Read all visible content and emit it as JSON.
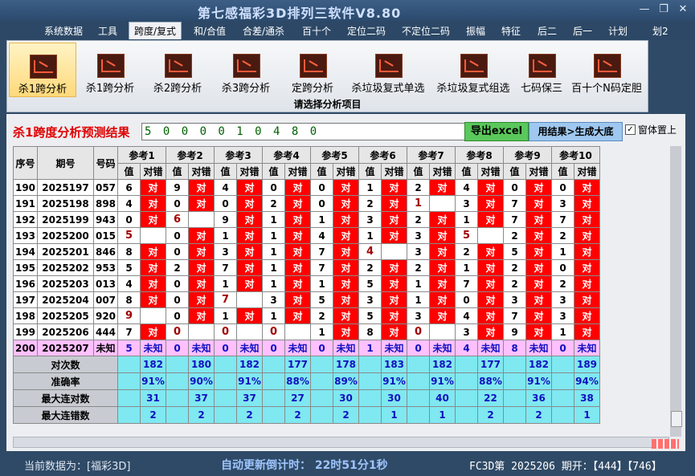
{
  "window": {
    "title": "第七感福彩3D排列三软件V8.80",
    "controls": [
      "—",
      "❐",
      "✕"
    ]
  },
  "menu": [
    "系统数据",
    "工具",
    "跨度/复式",
    "和/合值",
    "合差/通杀",
    "百十个",
    "定位二码",
    "不定位二码",
    "振幅",
    "特征",
    "后二",
    "后一",
    "计划",
    "划2"
  ],
  "ribbon": {
    "buttons": [
      "杀1跨分析",
      "杀1跨分析",
      "杀2跨分析",
      "杀3跨分析",
      "定跨分析",
      "杀垃圾复式单选",
      "杀垃圾复式组选",
      "七码保三",
      "百十个N码定胆"
    ],
    "caption": "请选择分析项目"
  },
  "result": {
    "label": "杀1跨度分析预测结果",
    "value": "5 0 0 0 0 1 0 4 8 0",
    "export_button": "导出excel",
    "generate_button": "用结果>生成大底",
    "pin_label": "窗体置上",
    "pin_checked": "✓"
  },
  "table": {
    "col_headers": [
      "序号",
      "期号",
      "号码"
    ],
    "ref_headers": [
      "参考1",
      "参考2",
      "参考3",
      "参考4",
      "参考5",
      "参考6",
      "参考7",
      "参考8",
      "参考9",
      "参考10"
    ],
    "sub_value": "值",
    "sub_check": "对错",
    "hit_text": "对",
    "rows": [
      {
        "id": "190",
        "issue": "2025197",
        "num": "057",
        "vals": [
          "6",
          "9",
          "4",
          "0",
          "0",
          "1",
          "2",
          "4",
          "0",
          "0"
        ],
        "ok": [
          1,
          1,
          1,
          1,
          1,
          1,
          1,
          1,
          1,
          1
        ]
      },
      {
        "id": "191",
        "issue": "2025198",
        "num": "898",
        "vals": [
          "4",
          "0",
          "0",
          "2",
          "0",
          "2",
          "1",
          "3",
          "7",
          "3"
        ],
        "ok": [
          1,
          1,
          1,
          1,
          1,
          1,
          0,
          1,
          1,
          1
        ]
      },
      {
        "id": "192",
        "issue": "2025199",
        "num": "943",
        "vals": [
          "0",
          "6",
          "9",
          "1",
          "1",
          "3",
          "2",
          "1",
          "7",
          "7"
        ],
        "ok": [
          1,
          0,
          1,
          1,
          1,
          1,
          1,
          1,
          1,
          1
        ]
      },
      {
        "id": "193",
        "issue": "2025200",
        "num": "015",
        "vals": [
          "5",
          "0",
          "1",
          "1",
          "4",
          "1",
          "3",
          "5",
          "2",
          "2"
        ],
        "ok": [
          0,
          1,
          1,
          1,
          1,
          1,
          1,
          0,
          1,
          1
        ]
      },
      {
        "id": "194",
        "issue": "2025201",
        "num": "846",
        "vals": [
          "8",
          "0",
          "3",
          "1",
          "7",
          "4",
          "3",
          "2",
          "5",
          "1"
        ],
        "ok": [
          1,
          1,
          1,
          1,
          1,
          0,
          1,
          1,
          1,
          1
        ]
      },
      {
        "id": "195",
        "issue": "2025202",
        "num": "953",
        "vals": [
          "5",
          "2",
          "7",
          "1",
          "7",
          "2",
          "2",
          "1",
          "2",
          "0"
        ],
        "ok": [
          1,
          1,
          1,
          1,
          1,
          1,
          1,
          1,
          1,
          1
        ]
      },
      {
        "id": "196",
        "issue": "2025203",
        "num": "013",
        "vals": [
          "4",
          "0",
          "1",
          "1",
          "1",
          "5",
          "1",
          "7",
          "2",
          "2"
        ],
        "ok": [
          1,
          1,
          1,
          1,
          1,
          1,
          1,
          1,
          1,
          1
        ]
      },
      {
        "id": "197",
        "issue": "2025204",
        "num": "007",
        "vals": [
          "8",
          "0",
          "7",
          "3",
          "5",
          "3",
          "1",
          "0",
          "3",
          "3"
        ],
        "ok": [
          1,
          1,
          0,
          1,
          1,
          1,
          1,
          1,
          1,
          1
        ]
      },
      {
        "id": "198",
        "issue": "2025205",
        "num": "920",
        "vals": [
          "9",
          "0",
          "1",
          "1",
          "2",
          "5",
          "3",
          "4",
          "7",
          "3"
        ],
        "ok": [
          0,
          1,
          1,
          1,
          1,
          1,
          1,
          1,
          1,
          1
        ]
      },
      {
        "id": "199",
        "issue": "2025206",
        "num": "444",
        "vals": [
          "7",
          "0",
          "0",
          "0",
          "1",
          "8",
          "0",
          "3",
          "9",
          "1"
        ],
        "ok": [
          1,
          0,
          0,
          0,
          1,
          1,
          0,
          1,
          1,
          1
        ]
      }
    ],
    "unknown_row": {
      "id": "200",
      "issue": "2025207",
      "num": "未知",
      "vals": [
        "5",
        "0",
        "0",
        "0",
        "0",
        "1",
        "0",
        "4",
        "8",
        "0"
      ],
      "status": "未知"
    },
    "stats": [
      {
        "label": "对次数",
        "values": [
          "182",
          "180",
          "182",
          "177",
          "178",
          "183",
          "182",
          "177",
          "182",
          "189"
        ]
      },
      {
        "label": "准确率",
        "values": [
          "91%",
          "90%",
          "91%",
          "88%",
          "89%",
          "91%",
          "91%",
          "88%",
          "91%",
          "94%"
        ]
      },
      {
        "label": "最大连对数",
        "values": [
          "31",
          "37",
          "37",
          "27",
          "30",
          "30",
          "40",
          "22",
          "36",
          "38"
        ]
      },
      {
        "label": "最大连错数",
        "values": [
          "2",
          "2",
          "2",
          "2",
          "2",
          "1",
          "1",
          "2",
          "2",
          "1"
        ]
      }
    ]
  },
  "statusbar": {
    "current_data": "当前数据为：[福彩3D]",
    "countdown": "自动更新倒计时： 22时51分1秒",
    "draw": "FC3D第 2025206 期开：【444】【746】"
  }
}
